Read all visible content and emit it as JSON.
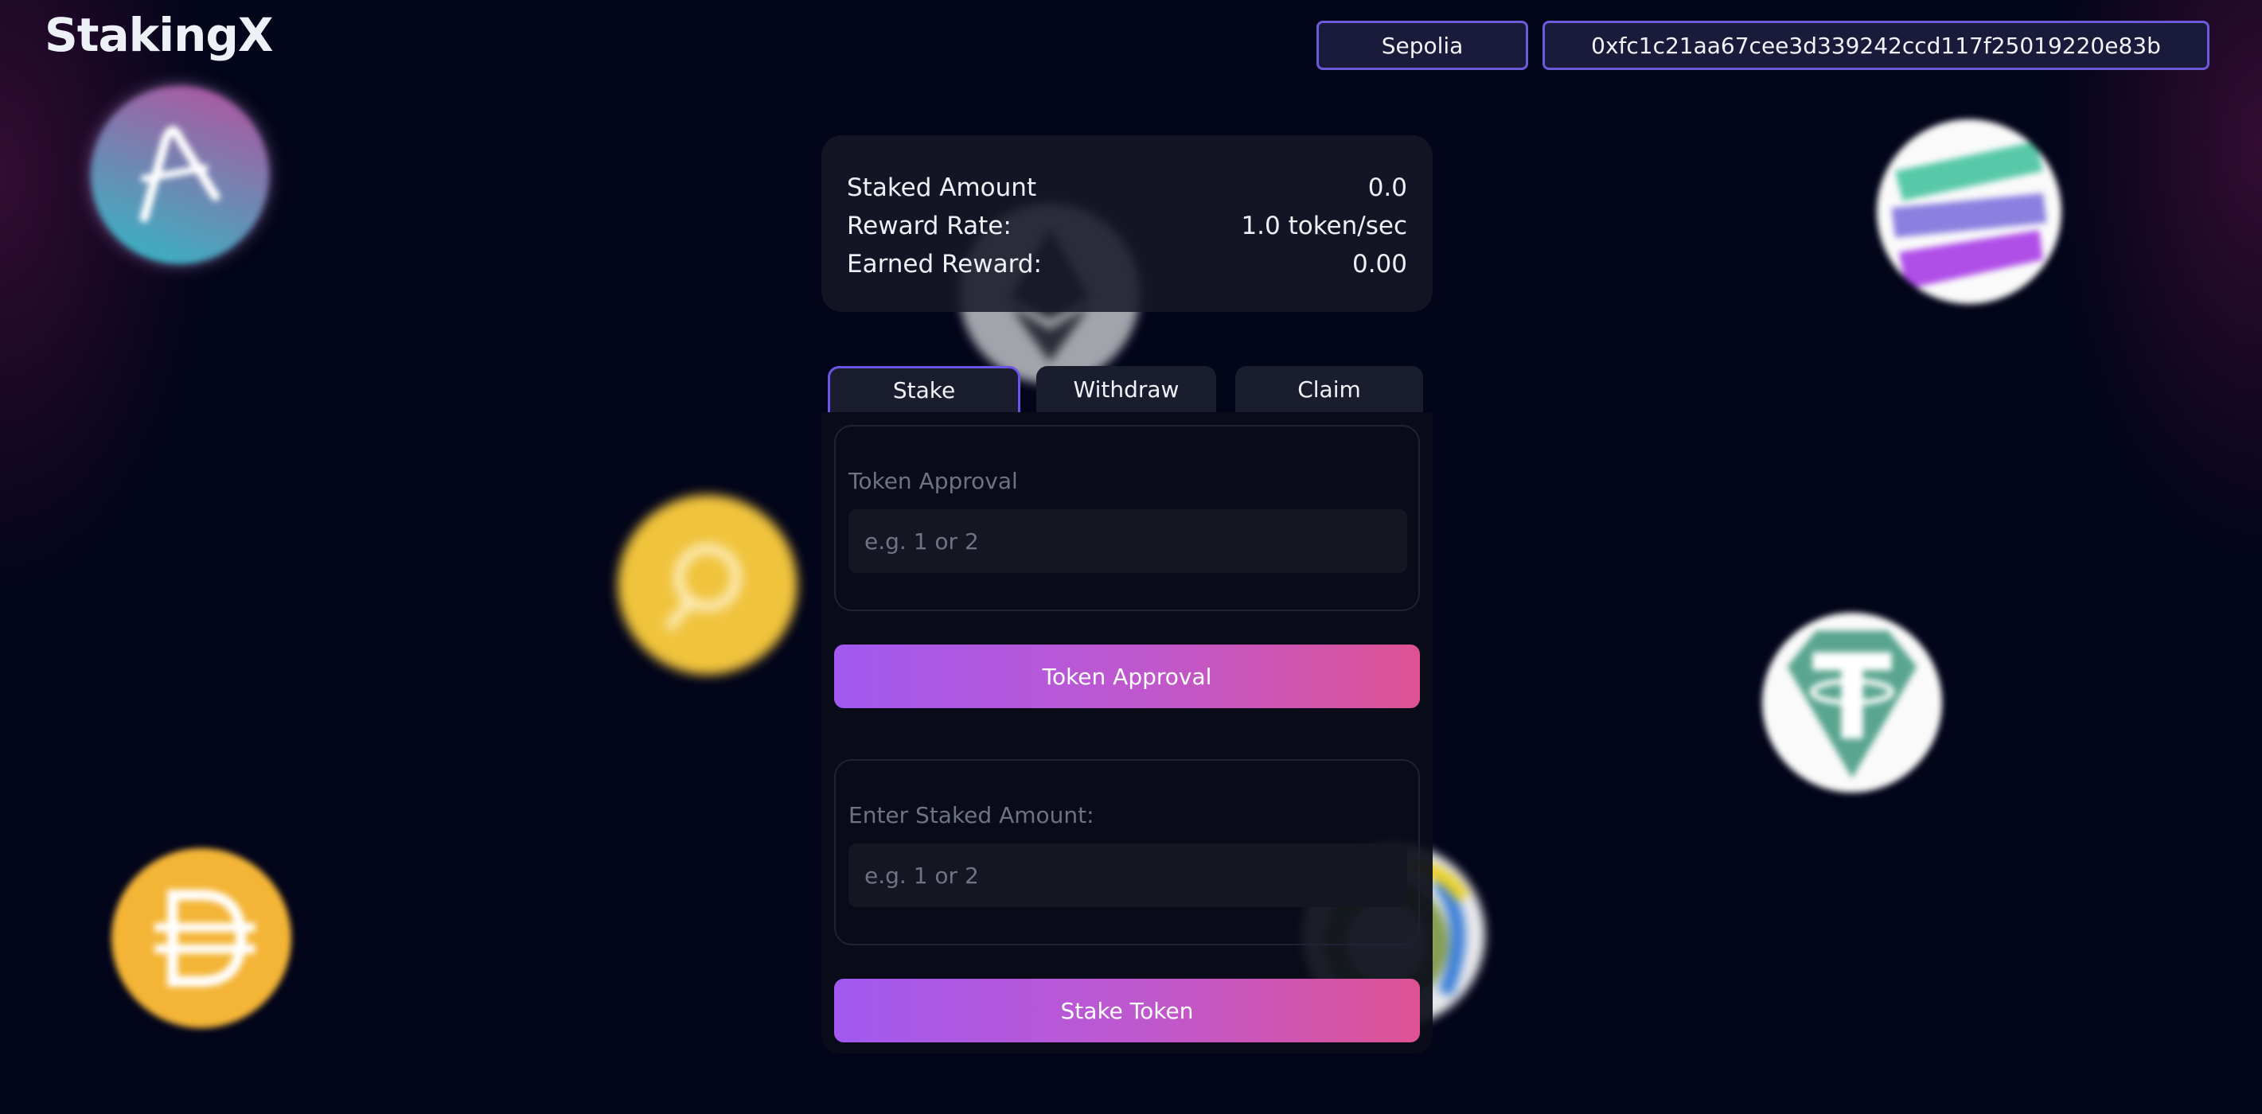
{
  "app": {
    "logo": "StakingX"
  },
  "header": {
    "network": "Sepolia",
    "wallet_address": "0xfc1c21aa67cee3d339242ccd117f25019220e83b"
  },
  "info": {
    "rows": [
      {
        "label": "Staked Amount",
        "value": "0.0"
      },
      {
        "label": "Reward Rate:",
        "value": "1.0 token/sec"
      },
      {
        "label": "Earned Reward:",
        "value": "0.00"
      }
    ]
  },
  "tabs": [
    {
      "label": "Stake",
      "active": true
    },
    {
      "label": "Withdraw",
      "active": false
    },
    {
      "label": "Claim",
      "active": false
    }
  ],
  "approval": {
    "label": "Token Approval",
    "placeholder": "e.g. 1 or 2",
    "value": "",
    "button": "Token Approval"
  },
  "stake": {
    "label": "Enter Staked Amount:",
    "placeholder": "e.g. 1 or 2",
    "value": "",
    "button": "Stake Token"
  },
  "decor": {
    "coins": [
      "aave-coin-icon",
      "ethereum-coin-icon",
      "solana-coin-icon",
      "the-graph-coin-icon",
      "tether-coin-icon",
      "dai-coin-icon",
      "ring-coin-icon"
    ],
    "accent": "#6b5bd9",
    "gradient_start": "#a259f0",
    "gradient_end": "#dd5293",
    "background": "#03051a"
  }
}
